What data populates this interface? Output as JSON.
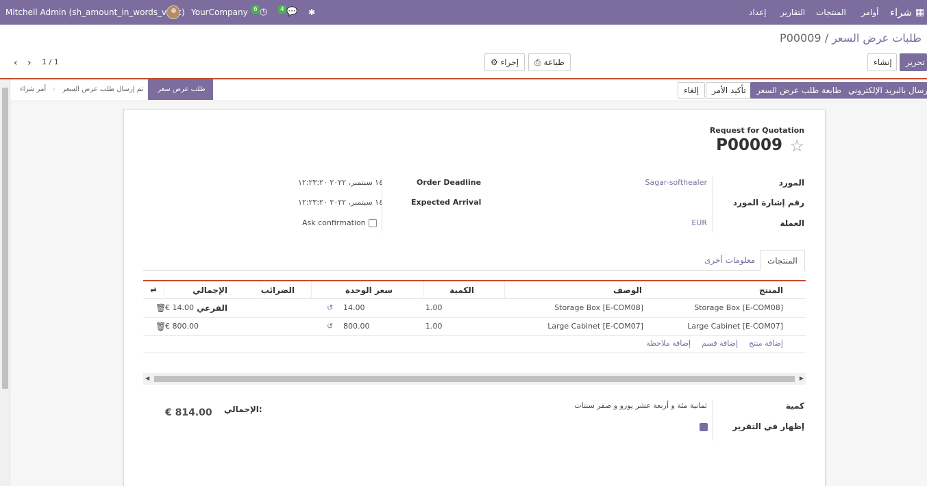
{
  "navbar": {
    "user": "Mitchell Admin (sh_amount_in_words_v16c)",
    "company": "YourCompany",
    "activity_count": "6",
    "message_count": "4",
    "app_name": "شراء",
    "menu": [
      "أوامر",
      "المنتجات",
      "التقارير",
      "إعداد"
    ],
    "icons": [
      "apps-grid-icon",
      "clock-icon",
      "chat-icon",
      "bug-icon"
    ]
  },
  "breadcrumb": {
    "parent": "طلبات عرض السعر",
    "separator": "/",
    "current": "P00009"
  },
  "toolbar": {
    "edit": "تحرير",
    "create": "إنشاء",
    "print": "طباعة",
    "action": "إجراء",
    "pager": "1 / 1"
  },
  "statusbar": {
    "buttons": {
      "send_email": "إرسال بالبريد الإلكتروني",
      "print_rfq": "طابعة طلب عرض السعر",
      "confirm": "تأكيد الأمر",
      "cancel": "إلغاء"
    },
    "stages": [
      "طلب عرض سعر",
      "تم إرسال طلب عرض السعر",
      "أمر شراء"
    ],
    "active_stage": "طلب عرض سعر"
  },
  "form": {
    "doc_type": "Request for Quotation",
    "doc_number": "P00009",
    "vendor_label": "المورد",
    "vendor_value": "Sagar-softhealer",
    "vendor_ref_label": "رقم إشارة المورد",
    "currency_label": "العملة",
    "currency_value": "EUR",
    "order_deadline_label": "Order Deadline",
    "order_deadline_value": "١٤ سبتمبر، ٢٠٢٢ ١٢:٢٣:٢٠",
    "expected_arrival_label": "Expected Arrival",
    "expected_arrival_value": "١٤ سبتمبر، ٢٠٢٢ ١٢:٢٣:٢٠",
    "ask_confirmation_label": "Ask confirmation"
  },
  "tabs": [
    "المنتجات",
    "معلومات أخرى"
  ],
  "table": {
    "columns": [
      "المنتج",
      "الوصف",
      "الكمية",
      "سعر الوحدة",
      "الضرائب",
      "الإجمالي الفرعي"
    ],
    "rows": [
      {
        "product": "Storage Box [E-COM08]",
        "description": "Storage Box [E-COM08]",
        "qty": "1.00",
        "price": "14.00",
        "taxes": "",
        "subtotal": "€ 14.00"
      },
      {
        "product": "Large Cabinet [E-COM07]",
        "description": "Large Cabinet [E-COM07]",
        "qty": "1.00",
        "price": "800.00",
        "taxes": "",
        "subtotal": "€ 800.00"
      }
    ],
    "add_links": [
      "إضافة منتج",
      "إضافة قسم",
      "إضافة ملاحظة"
    ]
  },
  "footer": {
    "amount_label": "كمية",
    "amount_words": "ثمانية مئة و أربعة عشر يورو و صفر سنتات",
    "show_in_report_label": "إظهار في التقرير",
    "show_in_report_checked": true,
    "total_label": "الإجمالي:",
    "total_value": "€ 814.00"
  }
}
